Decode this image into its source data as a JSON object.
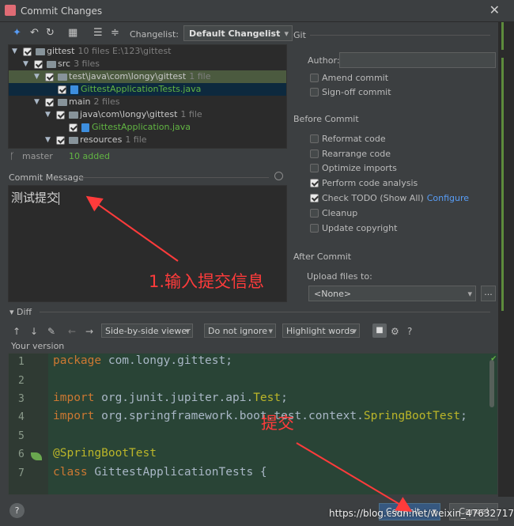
{
  "window": {
    "title": "Commit Changes",
    "close_glyph": "✕"
  },
  "toolbar": {
    "changelist_label": "Changelist:",
    "changelist_value": "Default Changelist"
  },
  "tree": [
    {
      "name": "gittest",
      "meta": "10 files  E:\\123\\gittest",
      "type": "folder"
    },
    {
      "name": "src",
      "meta": "3 files",
      "type": "folder"
    },
    {
      "name": "test\\java\\com\\longy\\gittest",
      "meta": "1 file",
      "type": "folder"
    },
    {
      "name": "GittestApplicationTests.java",
      "meta": "",
      "type": "file"
    },
    {
      "name": "main",
      "meta": "2 files",
      "type": "folder"
    },
    {
      "name": "java\\com\\longy\\gittest",
      "meta": "1 file",
      "type": "folder"
    },
    {
      "name": "GittestApplication.java",
      "meta": "",
      "type": "file"
    },
    {
      "name": "resources",
      "meta": "1 file",
      "type": "folder"
    }
  ],
  "branch": {
    "name": "master",
    "added": "10 added"
  },
  "commit_message": {
    "label": "Commit Message",
    "text": "测试提交"
  },
  "git": {
    "section_label": "Git",
    "author_label": "Author:",
    "amend_commit": "Amend commit",
    "signoff_commit": "Sign-off commit"
  },
  "before_commit": {
    "label": "Before Commit",
    "reformat_code": "Reformat code",
    "rearrange_code": "Rearrange code",
    "optimize_imports": "Optimize imports",
    "perform_code_analysis": "Perform code analysis",
    "check_todo": "Check TODO (Show All)",
    "configure_link": "Configure",
    "cleanup": "Cleanup",
    "update_copyright": "Update copyright"
  },
  "after_commit": {
    "label": "After Commit",
    "upload_label": "Upload files to:",
    "upload_value": "<None>",
    "more": "..."
  },
  "diff": {
    "label": "Diff",
    "viewer": "Side-by-side viewer",
    "ignore": "Do not ignore",
    "highlight": "Highlight words",
    "help": "?",
    "your_version": "Your version",
    "lines": [
      "1",
      "2",
      "3",
      "4",
      "5",
      "6",
      "7"
    ],
    "code": {
      "l1_kw": "package",
      "l1_rest": " com.longy.gittest;",
      "l3_kw": "import",
      "l3_rest": " org.junit.jupiter.api.",
      "l3_cls": "Test",
      "l3_end": ";",
      "l4_kw": "import",
      "l4_rest": " org.springframework.boot.test.context.",
      "l4_cls": "SpringBootTest",
      "l4_end": ";",
      "l6_ann": "@SpringBootTest",
      "l7_kw": "class",
      "l7_rest": " GittestApplicationTests {"
    }
  },
  "footer": {
    "help": "?",
    "commit_button": "Commit",
    "cancel_button": "Cancel"
  },
  "annotations": {
    "step1": "1.输入提交信息",
    "step2": "提交"
  },
  "watermark": "https://blog.csdn.net/weixin_47632717",
  "colors": {
    "background": "#3c3f41",
    "editor_bg": "#2b2b2b",
    "diff_added_bg": "#294436",
    "annotation_red": "#ff3b3b",
    "keyword": "#cc7832",
    "added_green": "#62b543",
    "link_blue": "#589df6"
  }
}
